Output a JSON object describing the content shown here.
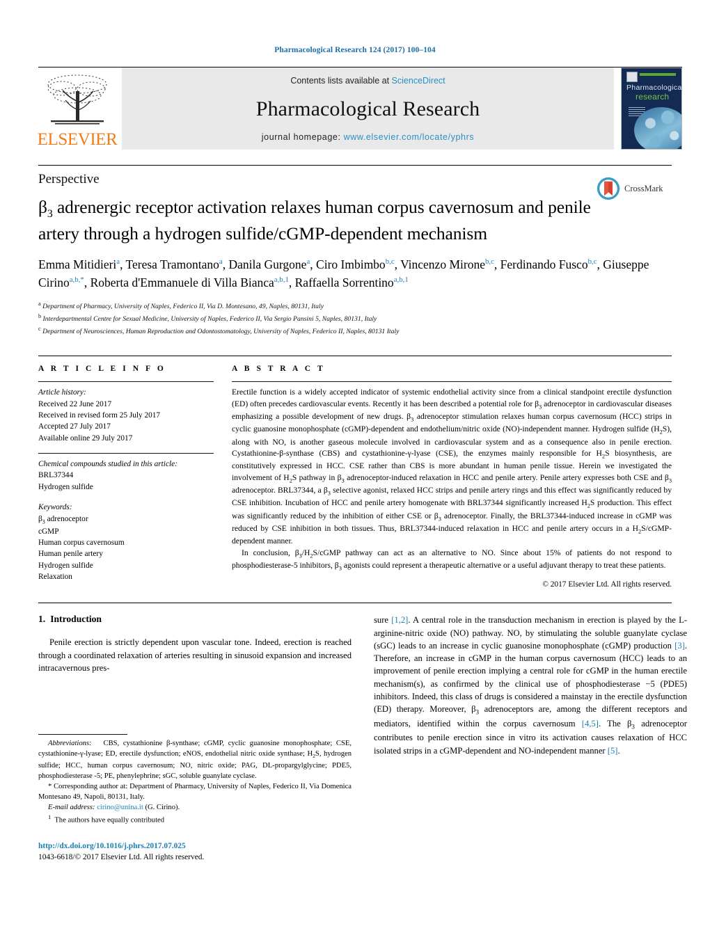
{
  "running_head": "Pharmacological Research 124 (2017) 100–104",
  "masthead": {
    "publisher_wordmark": "ELSEVIER",
    "contents_prefix": "Contents lists available at",
    "contents_link": "ScienceDirect",
    "journal_name": "Pharmacological Research",
    "homepage_prefix": "journal homepage:",
    "homepage_url": "www.elsevier.com/locate/yphrs",
    "cover": {
      "line1": "Pharmacological",
      "line2": "research"
    },
    "accent_link_color": "#2a8fc4",
    "elsevier_orange": "#f07d18"
  },
  "article": {
    "type_label": "Perspective",
    "title_part1": "β",
    "title_sub": "3",
    "title_rest": " adrenergic receptor activation relaxes human corpus cavernosum and penile artery through a hydrogen sulfide/cGMP-dependent mechanism",
    "crossmark_label": "CrossMark",
    "authors_line1": "Emma Mitidieri",
    "authors_html": "Emma Mitidieri<sup>a</sup>, Teresa Tramontano<sup>a</sup>, Danila Gurgone<sup>a</sup>, Ciro Imbimbo<sup>b,c</sup>, Vincenzo Mirone<sup>b,c</sup>, Ferdinando Fusco<sup>b,c</sup>, Giuseppe Cirino<sup>a,b,*</sup>, Roberta d'Emmanuele di Villa Bianca<sup>a,b,1</sup>, Raffaella Sorrentino<sup>a,b,1</sup>",
    "affiliations": [
      {
        "marker": "a",
        "text": "Department of Pharmacy, University of Naples, Federico II, Via D. Montesano, 49, Naples, 80131, Italy"
      },
      {
        "marker": "b",
        "text": "Interdepartmental Centre for Sexual Medicine, University of Naples, Federico II, Via Sergio Pansini 5, Naples, 80131, Italy"
      },
      {
        "marker": "c",
        "text": "Department of Neurosciences, Human Reproduction and Odontostomatology, University of Naples, Federico II, Naples, 80131 Italy"
      }
    ]
  },
  "article_info": {
    "heading": "A R T I C L E  I N F O",
    "history_label": "Article history:",
    "history": [
      "Received 22 June 2017",
      "Received in revised form 25 July 2017",
      "Accepted 27 July 2017",
      "Available online 29 July 2017"
    ],
    "compounds_label": "Chemical compounds studied in this article:",
    "compounds": [
      "BRL37344",
      "Hydrogen sulfide"
    ],
    "keywords_label": "Keywords:",
    "keywords_first_html": "β<sub>3</sub> adrenoceptor",
    "keywords": [
      "cGMP",
      "Human corpus cavernosum",
      "Human penile artery",
      "Hydrogen sulfide",
      "Relaxation"
    ]
  },
  "abstract": {
    "heading": "A B S T R A C T",
    "p1_html": "Erectile function is a widely accepted indicator of systemic endothelial activity since from a clinical standpoint erectile dysfunction (ED) often precedes cardiovascular events. Recently it has been described a potential role for β<sub>3</sub> adrenoceptor in cardiovascular diseases emphasizing a possible development of new drugs. β<sub>3</sub> adrenoceptor stimulation relaxes human corpus cavernosum (HCC) strips in cyclic guanosine monophosphate (cGMP)-dependent and endothelium/nitric oxide (NO)-independent manner. Hydrogen sulfide (H<sub>2</sub>S), along with NO, is another gaseous molecule involved in cardiovascular system and as a consequence also in penile erection. Cystathionine-β-synthase (CBS) and cystathionine-γ-lyase (CSE), the enzymes mainly responsible for H<sub>2</sub>S biosynthesis, are constitutively expressed in HCC. CSE rather than CBS is more abundant in human penile tissue. Herein we investigated the involvement of H<sub>2</sub>S pathway in β<sub>3</sub> adrenoceptor-induced relaxation in HCC and penile artery. Penile artery expresses both CSE and β<sub>3</sub> adrenoceptor. BRL37344, a β<sub>3</sub> selective agonist, relaxed HCC strips and penile artery rings and this effect was significantly reduced by CSE inhibition. Incubation of HCC and penile artery homogenate with BRL37344 significantly increased H<sub>2</sub>S production. This effect was significantly reduced by the inhibition of either CSE or β<sub>3</sub> adrenoceptor. Finally, the BRL37344-induced increase in cGMP was reduced by CSE inhibition in both tissues. Thus, BRL37344-induced relaxation in HCC and penile artery occurs in a H<sub>2</sub>S/cGMP-dependent manner.",
    "p2_html": "In conclusion, β<sub>3</sub>/H<sub>2</sub>S/cGMP pathway can act as an alternative to NO. Since about 15% of patients do not respond to phosphodiesterase-5 inhibitors, β<sub>3</sub> agonists could represent a therapeutic alternative or a useful adjuvant therapy to treat these patients.",
    "copyright": "© 2017 Elsevier Ltd. All rights reserved."
  },
  "introduction": {
    "number": "1.",
    "heading": "Introduction",
    "left_col_html": "Penile erection is strictly dependent upon vascular tone. Indeed, erection is reached through a coordinated relaxation of arteries resulting in sinusoid expansion and increased intracavernous pres-",
    "right_col_html": "sure <span class=\"cite\">[1,2]</span>. A central role in the transduction mechanism in erection is played by the L-arginine-nitric oxide (NO) pathway. NO, by stimulating the soluble guanylate cyclase (sGC) leads to an increase in cyclic guanosine monophosphate (cGMP) production <span class=\"cite\">[3]</span>. Therefore, an increase in cGMP in the human corpus cavernosum (HCC) leads to an improvement of penile erection implying a central role for cGMP in the human erectile mechanism(s), as confirmed by the clinical use of phosphodiesterase −5 (PDE5) inhibitors. Indeed, this class of drugs is considered a mainstay in the erectile dysfunction (ED) therapy. Moreover, β<sub>3</sub> adrenoceptors are, among the different receptors and mediators, identified within the corpus cavernosum <span class=\"cite\">[4,5]</span>. The β<sub>3</sub> adrenoceptor contributes to penile erection since in vitro its activation causes relaxation of HCC isolated strips in a cGMP-dependent and NO-independent manner <span class=\"cite\">[5]</span>."
  },
  "footnotes": {
    "abbreviations_html": "<span class=\"it\">Abbreviations:</span>&nbsp;&nbsp; CBS, cystathionine β-synthase; cGMP, cyclic guanosine monophosphate; CSE, cystathionine-γ-lyase; ED, erectile dysfunction; eNOS, endothelial nitric oxide synthase; H<sub>2</sub>S, hydrogen sulfide; HCC, human corpus cavernosum; NO, nitric oxide; PAG, DL-propargylglycine; PDE5, phosphodiesterase -5; PE, phenylephrine; sGC, soluble guanylate cyclase.",
    "corresponding_html": "* Corresponding author at: Department of Pharmacy, University of Naples, Federico II, Via Domenica Montesano 49, Napoli, 80131, Italy.",
    "email_label": "E-mail address:",
    "email": "cirino@unina.it",
    "email_suffix": "(G. Cirino).",
    "equal_contrib_html": "<sup>1</sup>&nbsp; The authors have equally contributed"
  },
  "page_footer": {
    "doi": "http://dx.doi.org/10.1016/j.phrs.2017.07.025",
    "issn_line": "1043-6618/© 2017 Elsevier Ltd. All rights reserved."
  }
}
